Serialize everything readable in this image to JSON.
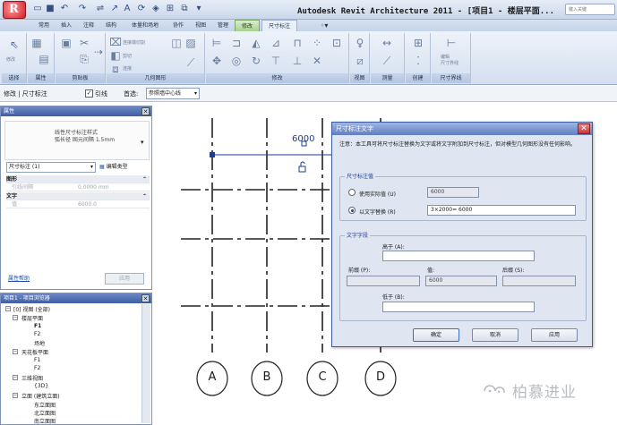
{
  "titlebar": {
    "title": "Autodesk Revit Architecture 2011 - [项目1 - 楼层平面...",
    "search_placeholder": "键入关键",
    "app_letter": "R"
  },
  "tabs": [
    "常用",
    "插入",
    "注释",
    "结构",
    "体量和场地",
    "协作",
    "视图",
    "管理",
    "修改",
    "尺寸标注"
  ],
  "ribbon": {
    "panels": [
      "选择",
      "属性",
      "剪贴板",
      "几何图形",
      "修改",
      "视图",
      "测量",
      "创建",
      "尺寸界线"
    ],
    "geometry_items": [
      "连接端切割",
      "剪切",
      "连接"
    ],
    "select_btn": "修改",
    "witness_btn": "编辑\n尺寸界线"
  },
  "options_bar": {
    "modify_label": "修改 | 尺寸标注",
    "leader_label": "引线",
    "leader_checked": "✓",
    "pref_label": "首选:",
    "pref_value": "参照墙中心线"
  },
  "properties": {
    "title": "属性",
    "type_family": "线性尺寸标注样式",
    "type_name": "弧长径 固元间隔 1.5mm",
    "selector": "尺寸标注 (1)",
    "edit_type": "编辑类型",
    "group_graphics": "图形",
    "row1_label": "引线间隔",
    "row1_value": "0.0000 mm",
    "group_text": "文字",
    "row2_label": "值",
    "row2_value": "6000.0",
    "help": "属性帮助",
    "apply": "应用"
  },
  "browser": {
    "title": "项目1 - 项目浏览器",
    "items": [
      "[0] 视图 (全部)",
      "楼层平面",
      "F1",
      "F2",
      "场地",
      "天花板平面",
      "F1",
      "F2",
      "三维视图",
      "{3D}",
      "立面 (建筑立面)",
      "东立面图",
      "北立面图",
      "南立面图"
    ]
  },
  "canvas": {
    "dimension_value": "6000",
    "grid_labels": [
      "A",
      "B",
      "C",
      "D"
    ]
  },
  "dialog": {
    "title": "尺寸标注文字",
    "close": "✕",
    "note": "注意：本工具可将尺寸标注替换为文字或将文字附加到尺寸标注，但对模型几何图形没有任何影响。",
    "value_group": "尺寸标注值",
    "use_actual_label": "使用实际值 (U)",
    "use_actual_value": "6000",
    "replace_label": "以文字替换 (R)",
    "replace_value": "3×2000= 6000",
    "text_group": "文字字段",
    "above_label": "高于 (A):",
    "prefix_label": "前缀 (P):",
    "value_label": "值:",
    "suffix_label": "后缀 (S):",
    "value_field": "6000",
    "below_label": "低于 (B):",
    "ok": "确定",
    "cancel": "取消",
    "apply": "应用"
  },
  "watermark": "柏慕进业",
  "colors": {
    "accent": "#3e5ea7",
    "context_tab": "#a8d190",
    "grid_blue": "#1d3c96"
  }
}
